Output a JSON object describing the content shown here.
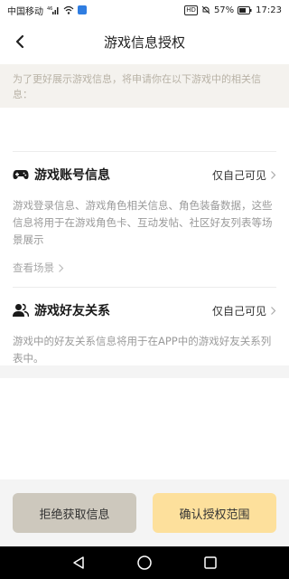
{
  "status_bar": {
    "carrier": "中国移动",
    "network": "46",
    "battery": "57%",
    "time": "17:23",
    "hd": "HD"
  },
  "header": {
    "title": "游戏信息授权"
  },
  "notice": {
    "text": "为了更好展示游戏信息，将申请你在以下游戏中的相关信息："
  },
  "sections": [
    {
      "title": "游戏账号信息",
      "visibility": "仅自己可见",
      "description": "游戏登录信息、游戏角色相关信息、角色装备数据，这些信息将用于在游戏角色卡、互动发帖、社区好友列表等场景展示",
      "view_scene": "查看场景"
    },
    {
      "title": "游戏好友关系",
      "visibility": "仅自己可见",
      "description": "游戏中的好友关系信息将用于在APP中的游戏好友关系列表中。"
    }
  ],
  "actions": {
    "reject": "拒绝获取信息",
    "confirm": "确认授权范围"
  },
  "colors": {
    "confirm_button": "#fde09c",
    "reject_button": "#cdc8bd",
    "notice_bg": "#f4f2ee"
  }
}
